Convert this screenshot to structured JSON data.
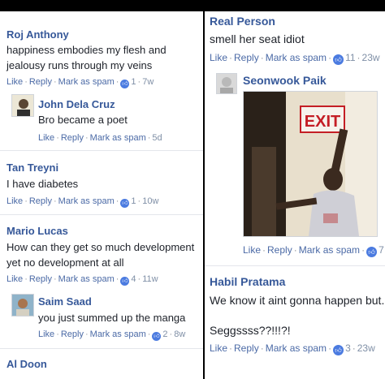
{
  "colors": {
    "link": "#365899",
    "meta": "#7f8fa6",
    "like_badge": "#4b7be0",
    "exit_sign": "#c41e25"
  },
  "actions": {
    "like": "Like",
    "reply": "Reply",
    "mark_spam": "Mark as spam",
    "sep": "·"
  },
  "left": {
    "c1": {
      "name": "Roj Anthony",
      "line1": "happiness embodies my flesh and",
      "line2": "jealousy runs through my veins",
      "likes": "1",
      "time": "7w"
    },
    "r1": {
      "name": "John Dela Cruz",
      "text": "Bro became a poet",
      "time": "5d"
    },
    "c2": {
      "name": "Tan Treyni",
      "text": "I have diabetes",
      "likes": "1",
      "time": "10w"
    },
    "c3": {
      "name": "Mario Lucas",
      "line1": "How can they get so much development",
      "line2": "yet no development at all",
      "likes": "4",
      "time": "11w"
    },
    "r2": {
      "name": "Saim Saad",
      "text": "you just summed up the manga",
      "likes": "2",
      "time": "8w"
    },
    "c4": {
      "name": "Al Doon"
    }
  },
  "right": {
    "c1": {
      "name": "Real Person",
      "text": "smell her seat idiot",
      "likes": "11",
      "time": "23w"
    },
    "r1": {
      "name": "Seonwook Paik",
      "sign": "EXIT",
      "likes": "7"
    },
    "c2": {
      "name": "Habil Pratama",
      "text": "We know it aint gonna happen but..",
      "text2": "Seggssss??!!!?!",
      "likes": "3",
      "time": "23w"
    }
  }
}
